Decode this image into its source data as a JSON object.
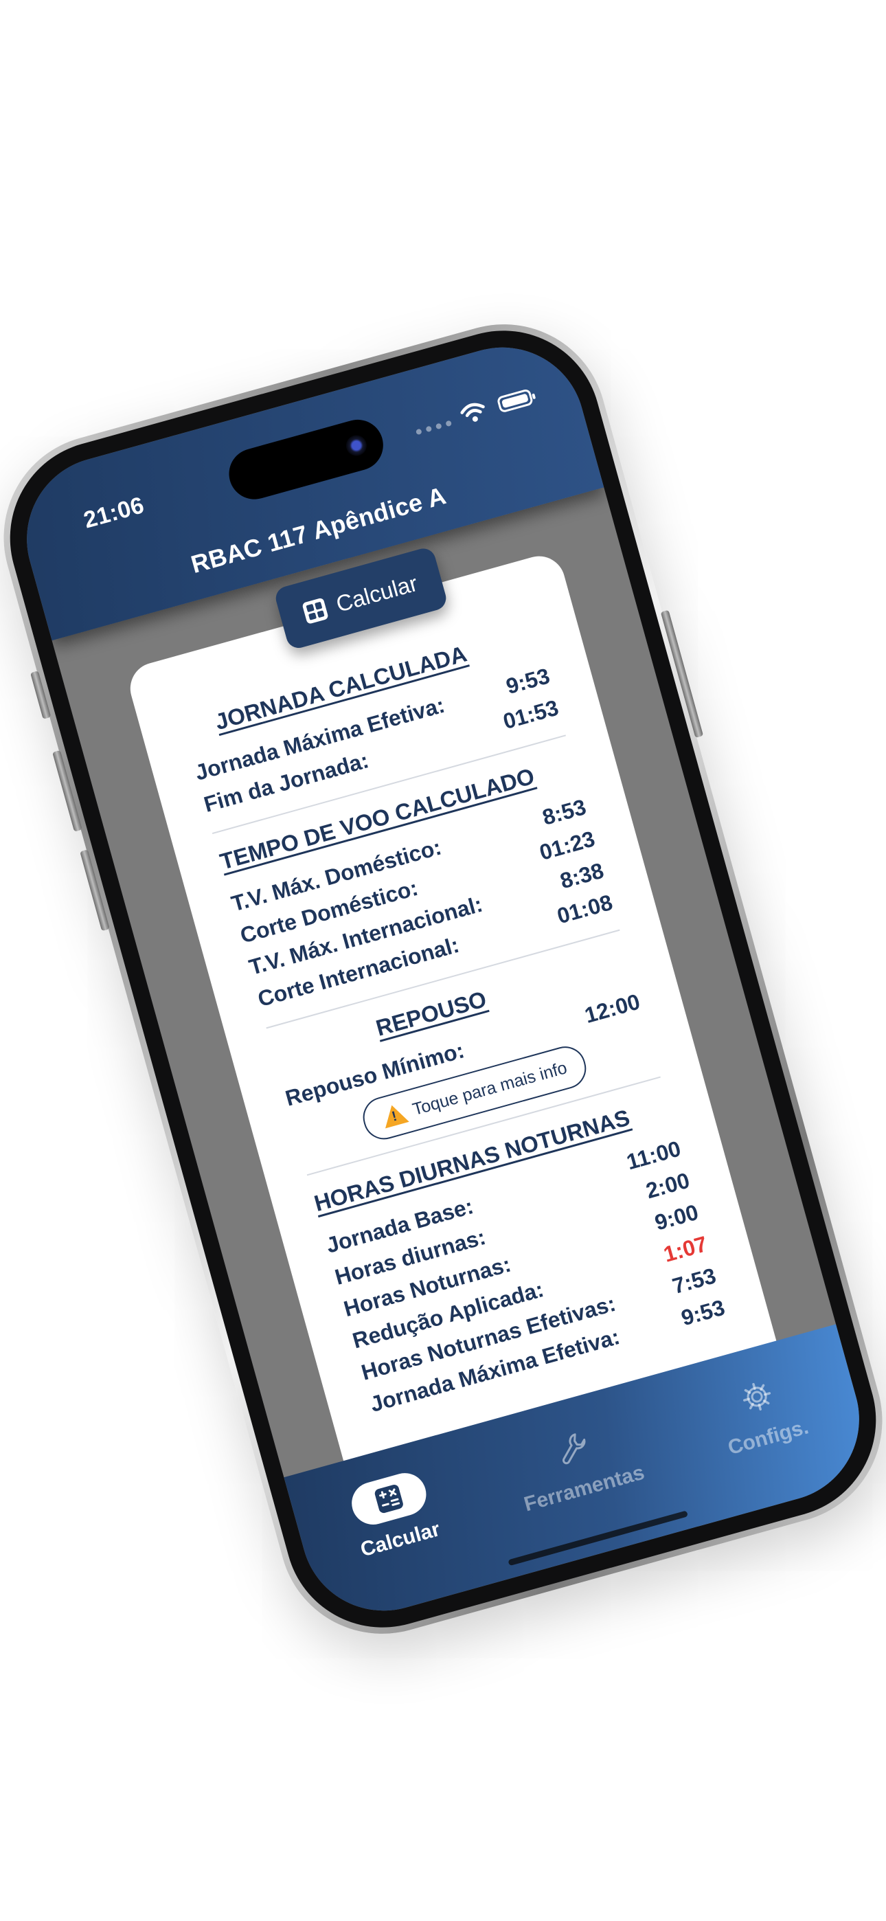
{
  "status_bar": {
    "time": "21:06"
  },
  "header": {
    "title": "RBAC 117 Apêndice A"
  },
  "calc_button": {
    "label": "Calcular",
    "icon": "calculator-icon"
  },
  "sections": [
    {
      "title": "JORNADA CALCULADA",
      "rows": [
        {
          "label": "Jornada Máxima Efetiva:",
          "value": "9:53"
        },
        {
          "label": "Fim da Jornada:",
          "value": "01:53"
        }
      ]
    },
    {
      "title": "TEMPO DE VOO CALCULADO",
      "rows": [
        {
          "label": "T.V. Máx. Doméstico:",
          "value": "8:53"
        },
        {
          "label": "Corte Doméstico:",
          "value": "01:23"
        },
        {
          "label": "T.V. Máx. Internacional:",
          "value": "8:38"
        },
        {
          "label": "Corte Internacional:",
          "value": "01:08"
        }
      ]
    },
    {
      "title": "REPOUSO",
      "rows": [
        {
          "label": "Repouso Mínimo:",
          "value": "12:00"
        }
      ],
      "info_button": {
        "label": "Toque para mais info",
        "icon": "warning-icon"
      }
    },
    {
      "title": "HORAS DIURNAS NOTURNAS",
      "rows": [
        {
          "label": "Jornada Base:",
          "value": "11:00"
        },
        {
          "label": "Horas diurnas:",
          "value": "2:00"
        },
        {
          "label": "Horas Noturnas:",
          "value": "9:00"
        },
        {
          "label": "Redução Aplicada:",
          "value": "1:07",
          "highlight": "#e53935"
        },
        {
          "label": "Horas Noturnas Efetivas:",
          "value": "7:53"
        },
        {
          "label": "Jornada Máxima Efetiva:",
          "value": "9:53"
        }
      ]
    }
  ],
  "tabbar": {
    "tabs": [
      {
        "label": "Calcular",
        "icon": "calculator-icon",
        "active": true
      },
      {
        "label": "Ferramentas",
        "icon": "wrench-icon",
        "active": false
      },
      {
        "label": "Configs.",
        "icon": "gear-icon",
        "active": false
      }
    ]
  },
  "colors": {
    "primary": "#1f3b63",
    "accent_gradient_end": "#4a8bd6",
    "text": "#1e355a",
    "highlight_red": "#e53935",
    "warning": "#f5a623"
  }
}
